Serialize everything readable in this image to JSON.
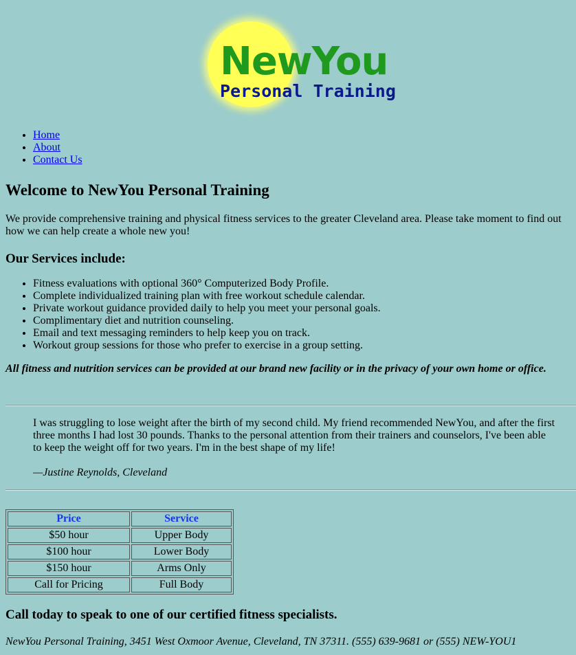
{
  "logo": {
    "name": "NewYou",
    "subtitle": "Personal Training"
  },
  "nav": {
    "items": [
      "Home",
      "About",
      "Contact Us"
    ]
  },
  "welcome_title": "Welcome to NewYou Personal Training",
  "intro": "We provide comprehensive training and physical fitness services to the greater Cleveland area. Please take moment to find out how we can help create a whole new you!",
  "services": {
    "heading": "Our Services include:",
    "items": [
      "Fitness evaluations with optional 360° Computerized Body Profile.",
      "Complete individualized training plan with free workout schedule calendar.",
      "Private workout guidance provided daily to help you meet your personal goals.",
      "Complimentary diet and nutrition counseling.",
      "Email and text messaging reminders to help keep you on track.",
      "Workout group sessions for those who prefer to exercise in a group setting."
    ]
  },
  "note": "All fitness and nutrition services can be provided at our brand new facility or in the privacy of your own home or office.",
  "testimonial": {
    "text": "I was struggling to lose weight after the birth of my second child. My friend recommended NewYou, and after the first three months I had lost 30 pounds. Thanks to the personal attention from their trainers and counselors, I've been able to keep the weight off for two years. I'm in the best shape of my life!",
    "author": "—Justine Reynolds, Cleveland"
  },
  "pricing": {
    "headers": [
      "Price",
      "Service"
    ],
    "rows": [
      [
        "$50 hour",
        "Upper Body"
      ],
      [
        "$100 hour",
        "Lower Body"
      ],
      [
        "$150 hour",
        "Arms Only"
      ],
      [
        "Call for Pricing",
        "Full Body"
      ]
    ]
  },
  "call_to_action": "Call today to speak to one of our certified fitness specialists.",
  "address": "NewYou Personal Training, 3451 West Oxmoor Avenue, Cleveland, TN 37311. (555) 639-9681 or (555) NEW-YOU1",
  "colors": {
    "background": "#9ccccc",
    "logo_green": "#1f9a1f",
    "logo_blue": "#0a1a8a",
    "sun": "#ffff55",
    "table_header": "#1a35e8"
  }
}
